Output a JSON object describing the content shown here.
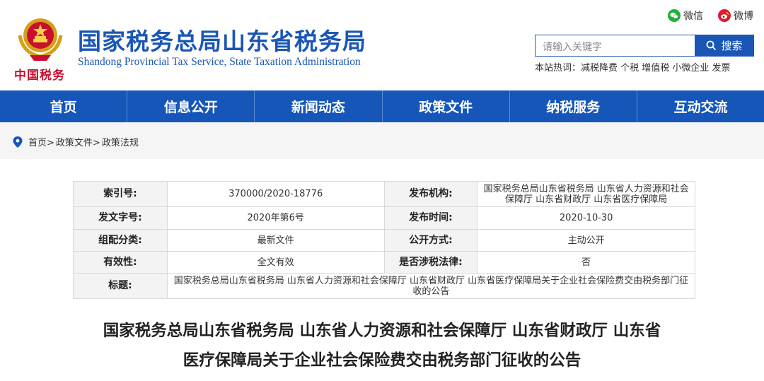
{
  "header": {
    "emblem_text": "中国税务",
    "title_cn": "国家税务总局山东省税务局",
    "title_en": "Shandong Provincial Tax Service, State Taxation Administration",
    "social": [
      {
        "label": "微信",
        "icon": "wechat-icon",
        "color": "#22b03c"
      },
      {
        "label": "微博",
        "icon": "weibo-icon",
        "color": "#e6162d"
      }
    ],
    "search": {
      "placeholder": "请输入关键字",
      "button_label": "搜索"
    },
    "hotwords": "本站热词：减税降费 个税 增值税 小微企业 发票"
  },
  "nav": {
    "items": [
      "首页",
      "信息公开",
      "新闻动态",
      "政策文件",
      "纳税服务",
      "互动交流"
    ]
  },
  "breadcrumb": {
    "items": [
      "首页>",
      "政策文件>",
      "政策法规"
    ]
  },
  "meta": {
    "index_no_label": "索引号:",
    "index_no": "370000/2020-18776",
    "issuer_label": "发布机构:",
    "issuer": "国家税务总局山东省税务局 山东省人力资源和社会保障厅 山东省财政厅 山东省医疗保障局",
    "doc_no_label": "发文字号:",
    "doc_no": "2020年第6号",
    "publish_time_label": "发布时间:",
    "publish_time": "2020-10-30",
    "category_label": "组配分类:",
    "category": "最新文件",
    "disclosure_label": "公开方式:",
    "disclosure": "主动公开",
    "validity_label": "有效性:",
    "validity": "全文有效",
    "tax_law_label": "是否涉税法律:",
    "tax_law": "否",
    "title_label": "标题:",
    "title": "国家税务总局山东省税务局 山东省人力资源和社会保障厅 山东省财政厅 山东省医疗保障局关于企业社会保险费交由税务部门征收的公告"
  },
  "article": {
    "title_line1": "国家税务总局山东省税务局 山东省人力资源和社会保障厅 山东省财政厅 山东省",
    "title_line2": "医疗保障局关于企业社会保险费交由税务部门征收的公告"
  },
  "colors": {
    "brand_blue": "#1a56b5",
    "nav_blue": "#1556b8",
    "emblem_red": "#c8102e"
  }
}
